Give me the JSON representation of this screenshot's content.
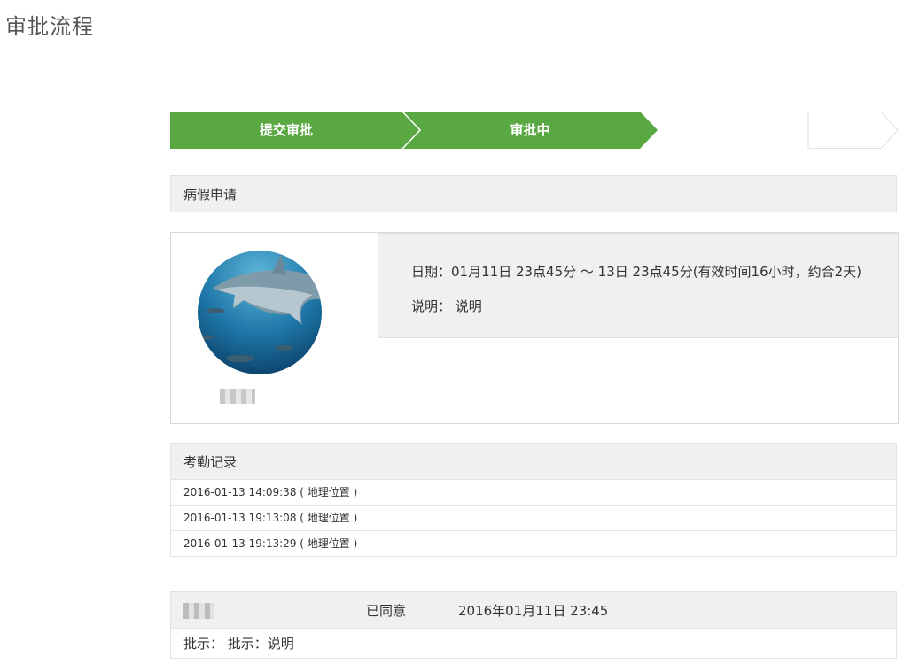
{
  "page": {
    "title": "审批流程"
  },
  "steps": [
    {
      "label": "提交审批",
      "state": "done"
    },
    {
      "label": "审批中",
      "state": "active"
    },
    {
      "label": "",
      "state": "pending"
    }
  ],
  "colors": {
    "step_active": "#5aa842",
    "panel_bg": "#f0f0f2"
  },
  "request": {
    "type_title": "病假申请"
  },
  "detail": {
    "date_label": "日期：",
    "date_value": "01月11日 23点45分 ～ 13日 23点45分(有效时间16小时，约合2天)",
    "note_label": "说明：",
    "note_value": "说明"
  },
  "attendance": {
    "title": "考勤记录",
    "records": [
      "2016-01-13 14:09:38 ( 地理位置 )",
      "2016-01-13 19:13:08 ( 地理位置 )",
      "2016-01-13 19:13:29 ( 地理位置 )"
    ]
  },
  "approval": {
    "status": "已同意",
    "time": "2016年01月11日 23:45",
    "comment_label": "批示：",
    "comment_value": "批示：说明"
  }
}
